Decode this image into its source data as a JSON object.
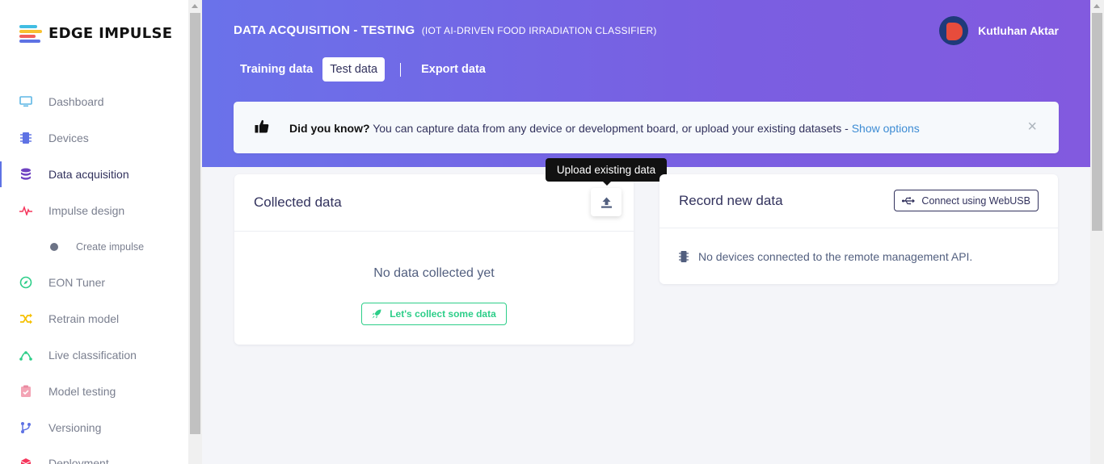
{
  "app": {
    "name": "EDGE IMPULSE"
  },
  "sidebar": {
    "items": [
      {
        "label": "Dashboard",
        "icon": "monitor-icon",
        "color": "#5fb7e5"
      },
      {
        "label": "Devices",
        "icon": "chip-icon",
        "color": "#5e72e4"
      },
      {
        "label": "Data acquisition",
        "icon": "database-icon",
        "color": "#6f42c1",
        "active": true
      },
      {
        "label": "Impulse design",
        "icon": "pulse-icon",
        "color": "#f5365c"
      },
      {
        "label": "Create impulse",
        "icon": "dot-icon",
        "sub": true
      },
      {
        "label": "EON Tuner",
        "icon": "compass-icon",
        "color": "#2dce89"
      },
      {
        "label": "Retrain model",
        "icon": "shuffle-icon",
        "color": "#f5c000"
      },
      {
        "label": "Live classification",
        "icon": "nodes-icon",
        "color": "#2dce89"
      },
      {
        "label": "Model testing",
        "icon": "clipboard-check-icon",
        "color": "#f3a4b5"
      },
      {
        "label": "Versioning",
        "icon": "branch-icon",
        "color": "#5e72e4"
      },
      {
        "label": "Deployment",
        "icon": "box-icon",
        "color": "#f5365c"
      }
    ]
  },
  "header": {
    "title": "DATA ACQUISITION - TESTING",
    "subtitle": "(IOT AI-DRIVEN FOOD IRRADIATION CLASSIFIER)",
    "user_name": "Kutluhan Aktar",
    "tabs": [
      {
        "label": "Training data"
      },
      {
        "label": "Test data",
        "active": true
      },
      {
        "label": "Export data"
      }
    ]
  },
  "banner": {
    "lead": "Did you know?",
    "text": " You can capture data from any device or development board, or upload your existing datasets - ",
    "link": "Show options",
    "close": "×"
  },
  "collected": {
    "title": "Collected data",
    "tooltip": "Upload existing data",
    "empty": "No data collected yet",
    "collect_btn": "Let's collect some data"
  },
  "record": {
    "title": "Record new data",
    "webusb_btn": "Connect using WebUSB",
    "no_devices": "No devices connected to the remote management API."
  }
}
